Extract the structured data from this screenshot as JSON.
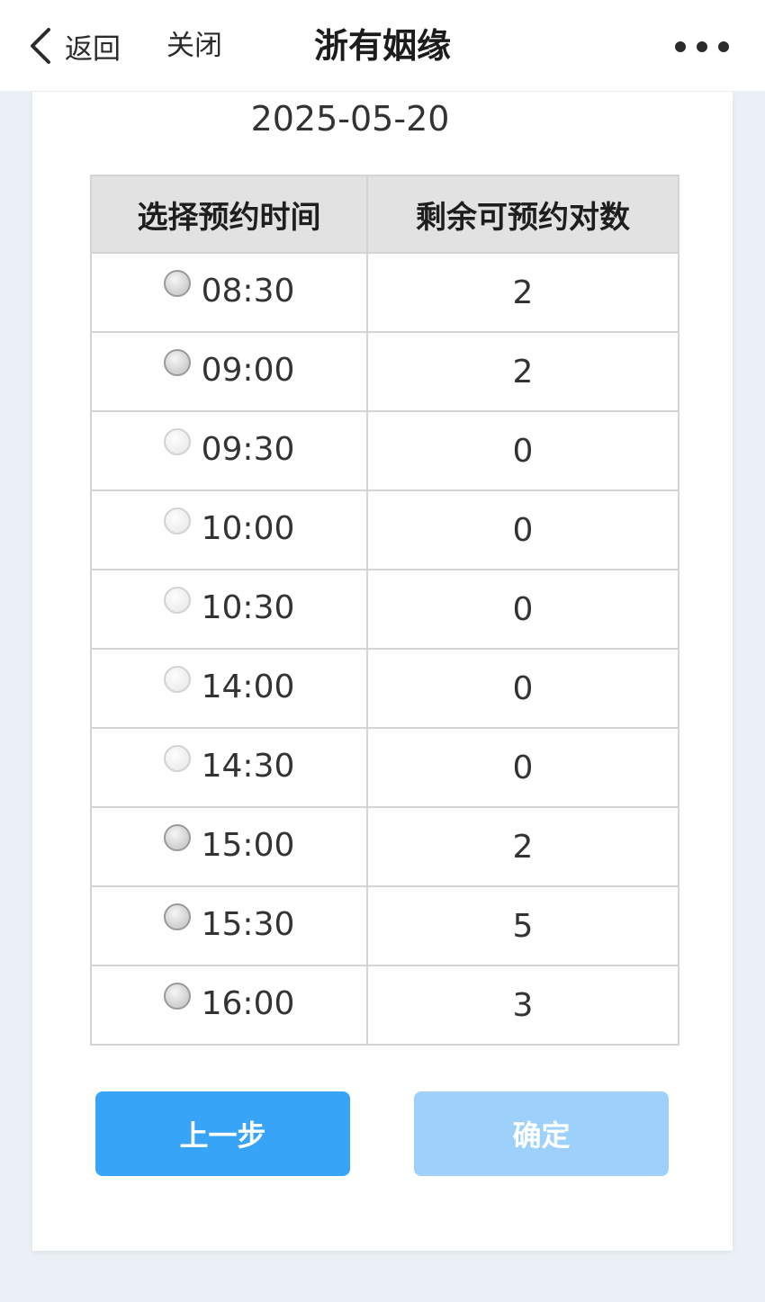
{
  "navbar": {
    "back_label": "返回",
    "close_label": "关闭",
    "title": "浙有姻缘"
  },
  "booking": {
    "date": "2025-05-20",
    "headers": {
      "time": "选择预约时间",
      "remaining": "剩余可预约对数"
    },
    "slots": [
      {
        "time": "08:30",
        "remaining": "2",
        "available": true
      },
      {
        "time": "09:00",
        "remaining": "2",
        "available": true
      },
      {
        "time": "09:30",
        "remaining": "0",
        "available": false
      },
      {
        "time": "10:00",
        "remaining": "0",
        "available": false
      },
      {
        "time": "10:30",
        "remaining": "0",
        "available": false
      },
      {
        "time": "14:00",
        "remaining": "0",
        "available": false
      },
      {
        "time": "14:30",
        "remaining": "0",
        "available": false
      },
      {
        "time": "15:00",
        "remaining": "2",
        "available": true
      },
      {
        "time": "15:30",
        "remaining": "5",
        "available": true
      },
      {
        "time": "16:00",
        "remaining": "3",
        "available": true
      }
    ]
  },
  "actions": {
    "prev_label": "上一步",
    "confirm_label": "确定"
  },
  "colors": {
    "primary": "#38a4f8",
    "primary_disabled": "#9dd0fb",
    "header_bg": "#e2e2e2",
    "page_bg": "#eaf0f5"
  }
}
